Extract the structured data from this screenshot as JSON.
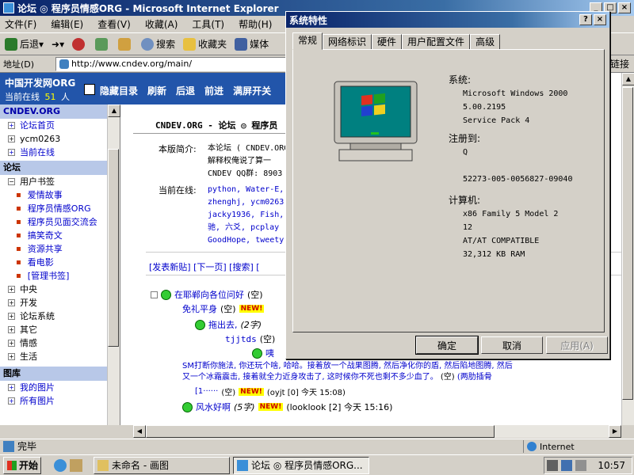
{
  "ie": {
    "title": "论坛 ◎ 程序员情感ORG - Microsoft Internet Explorer",
    "menu": [
      "文件(F)",
      "编辑(E)",
      "查看(V)",
      "收藏(A)",
      "工具(T)",
      "帮助(H)"
    ],
    "toolbar": {
      "back": "后退",
      "search": "搜索",
      "favorites": "收藏夹",
      "media": "媒体"
    },
    "address_label": "地址(D)",
    "address": "http://www.cndev.org/main/",
    "links_label": "链接"
  },
  "site": {
    "name": "中国开发网ORG",
    "online_prefix": "当前在线",
    "online_count": "51",
    "online_suffix": "人",
    "nav": [
      "隐藏目录",
      "刷新",
      "后退",
      "前进",
      "满屏开关"
    ]
  },
  "sidebar": {
    "section1": "CNDEV.ORG",
    "items1": [
      "论坛首页",
      "ycm0263",
      "当前在线"
    ],
    "section2": "论坛",
    "bookmark_group": "用户书签",
    "bookmarks": [
      "爱情故事",
      "程序员情感ORG",
      "程序员见面交流会",
      "搞笑奇文",
      "资源共享",
      "看电影",
      "[管理书签]"
    ],
    "groups": [
      "中央",
      "开发",
      "论坛系统",
      "其它",
      "情感",
      "生活"
    ],
    "section3": "图库",
    "gallery": [
      "我的图片",
      "所有图片"
    ]
  },
  "forum": {
    "header": "CNDEV.ORG - 论坛 ◎ 程序员",
    "intro_label": "本版简介:",
    "intro_lines": [
      "本论坛 ( CNDEV.ORG",
      "解释权俺说了算一",
      "CNDEV QQ群: 8903"
    ],
    "online_label": "当前在线:",
    "online_lines": [
      "python, Water-E,",
      "zhenghj, ycm0263",
      "jacky1936, Fish,",
      "驰, 六爻, pcplay",
      "GoodHope, tweety"
    ],
    "links": "[发表新贴] [下一页] [搜索] [",
    "posts": [
      {
        "title": "在耶郸向各位问好",
        "size": "(空)"
      },
      {
        "title": "免礼平身",
        "size": "(空)",
        "new": "NEW!"
      },
      {
        "title": "拖出去,",
        "size": "(2字)"
      },
      {
        "title": "tjjtds",
        "size": "(空)"
      },
      {
        "title": "咦",
        "size": ""
      },
      {
        "title": "SM打断你施法, 你还玩个啥, 哈哈。接着放一个战果图腾, 然后净化你的盾, 然后陷地图腾, 然后",
        "size": ""
      },
      {
        "title": "又一个冰霜震击, 接着就全力近身攻击了, 这时候你不死也剩不多少血了。",
        "size": "(空)",
        "tail": "(两肋插骨"
      },
      {
        "title": "[1······",
        "size": "(空)",
        "new": "NEW!",
        "meta": "(oyjt [0] 今天 15:08)"
      },
      {
        "title": "风水好啊",
        "size": "(5字)",
        "new": "NEW!",
        "meta": "(looklook [2] 今天 15:16)"
      }
    ]
  },
  "dialog": {
    "title": "系统特性",
    "tabs": [
      "常规",
      "网络标识",
      "硬件",
      "用户配置文件",
      "高级"
    ],
    "system_label": "系统:",
    "system_lines": [
      "Microsoft Windows 2000",
      "5.00.2195",
      "Service Pack 4"
    ],
    "registered_label": "注册到:",
    "registered_lines": [
      "Q",
      "",
      "52273-005-0056827-09040"
    ],
    "computer_label": "计算机:",
    "computer_lines": [
      "x86 Family 5 Model 2",
      "12",
      "AT/AT COMPATIBLE",
      "32,312 KB RAM"
    ],
    "ok": "确定",
    "cancel": "取消",
    "apply": "应用(A)"
  },
  "status": {
    "text": "完毕",
    "zone": "Internet"
  },
  "taskbar": {
    "start": "开始",
    "tasks": [
      "未命名 - 画图",
      "论坛 ◎ 程序员情感ORG..."
    ],
    "clock": "10:57"
  },
  "colors": {
    "titlebar": "#0a246a",
    "face": "#d4d0c8",
    "link": "#0000cc",
    "nav_bg": "#2255aa"
  }
}
